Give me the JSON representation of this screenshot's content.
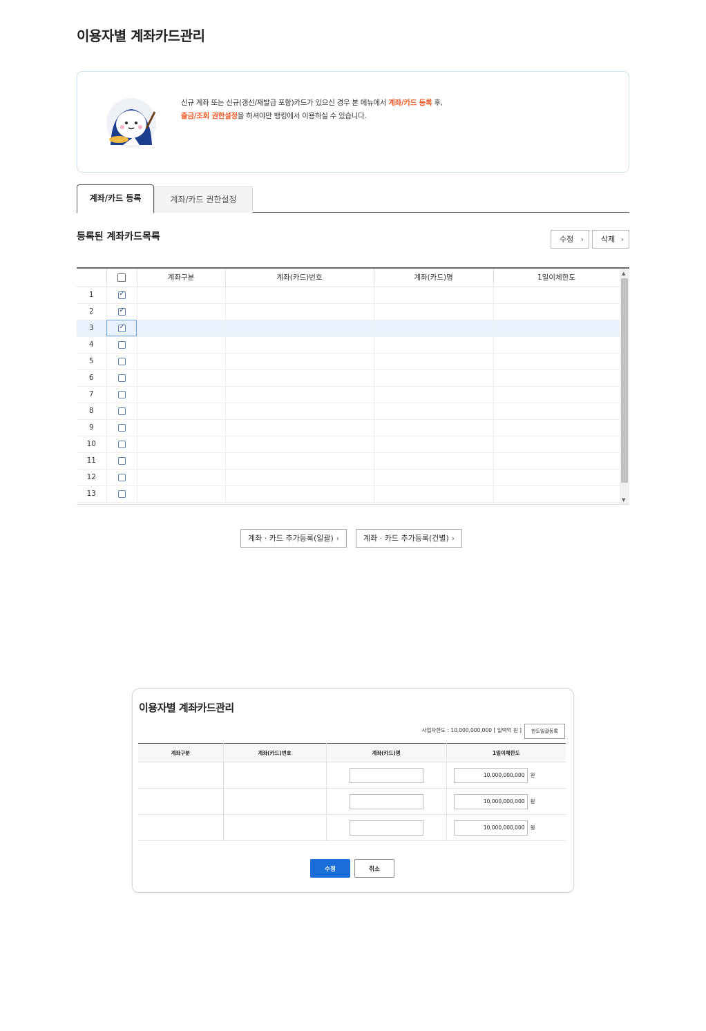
{
  "page": {
    "title": "이용자별 계좌카드관리"
  },
  "notice": {
    "line1_pre": "신규 계좌 또는 신규(갱신/재발급 포함)카드가 있으신 경우 본 메뉴에서 ",
    "line1_hl": "계좌/카드 등록",
    "line1_post": " 후,",
    "line2_hl": "출금/조회 권한설정",
    "line2_post": "을 하셔야만 뱅킹에서 이용하실 수 있습니다."
  },
  "tabs": [
    {
      "label": "계좌/카드 등록",
      "active": true
    },
    {
      "label": "계좌/카드 권한설정",
      "active": false
    }
  ],
  "list": {
    "title": "등록된 계좌카드목록",
    "edit_label": "수정",
    "delete_label": "삭제",
    "columns": [
      "계좌구분",
      "계좌(카드)번호",
      "계좌(카드)명",
      "1일이체한도"
    ],
    "rows": [
      {
        "no": "1",
        "checked": true
      },
      {
        "no": "2",
        "checked": true
      },
      {
        "no": "3",
        "checked": true,
        "selected": true
      },
      {
        "no": "4",
        "checked": false
      },
      {
        "no": "5",
        "checked": false
      },
      {
        "no": "6",
        "checked": false
      },
      {
        "no": "7",
        "checked": false
      },
      {
        "no": "8",
        "checked": false
      },
      {
        "no": "9",
        "checked": false
      },
      {
        "no": "10",
        "checked": false
      },
      {
        "no": "11",
        "checked": false
      },
      {
        "no": "12",
        "checked": false
      },
      {
        "no": "13",
        "checked": false
      }
    ]
  },
  "actions": {
    "bulk_add": "계좌 · 카드 추가등록(일괄)",
    "single_add": "계좌 · 카드 추가등록(건별)"
  },
  "modal": {
    "title": "이용자별 계좌카드관리",
    "limit_text": "사업자한도 : 10,000,000,000 [ 일백억 원 ]",
    "limit_button": "한도일괄등록",
    "columns": [
      "계좌구분",
      "계좌(카드)번호",
      "계좌(카드)명",
      "1일이체한도"
    ],
    "rows": [
      {
        "amount": "10,000,000,000",
        "unit": "원"
      },
      {
        "amount": "10,000,000,000",
        "unit": "원"
      },
      {
        "amount": "10,000,000,000",
        "unit": "원"
      }
    ],
    "save_label": "수정",
    "cancel_label": "취소"
  }
}
